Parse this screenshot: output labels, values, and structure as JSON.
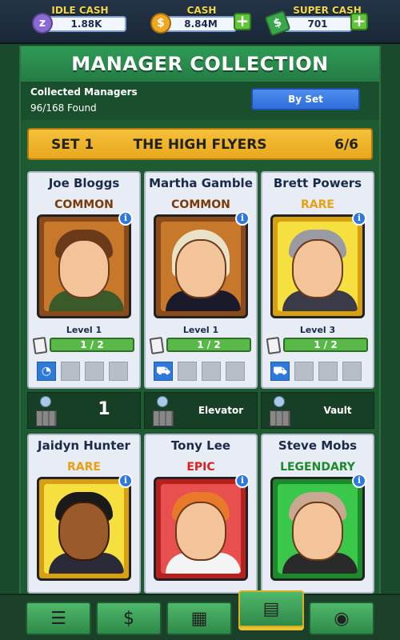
{
  "topbar": {
    "idle_cash": {
      "label": "IDLE CASH",
      "value": "1.88K",
      "icon": "idle-cash-icon"
    },
    "cash": {
      "label": "CASH",
      "value": "8.84M",
      "icon": "dollar-coin-icon"
    },
    "super_cash": {
      "label": "SUPER CASH",
      "value": "701",
      "icon": "super-cash-icon"
    }
  },
  "title": "MANAGER COLLECTION",
  "collected": {
    "label": "Collected Managers",
    "count": "96/168 Found"
  },
  "by_set_button": "By Set",
  "set": {
    "number": "SET 1",
    "name": "THE HIGH FLYERS",
    "progress": "6/6"
  },
  "managers": [
    {
      "name": "Joe Bloggs",
      "rarity": "COMMON",
      "rarity_color": "#7a3a0a",
      "level": "Level 1",
      "cards": "1 / 2",
      "frame": "#8a4a1a",
      "bg": "#c8782a",
      "hair": "#6a3a1a",
      "body": "#3a5a2a"
    },
    {
      "name": "Martha Gamble",
      "rarity": "COMMON",
      "rarity_color": "#7a3a0a",
      "level": "Level 1",
      "cards": "1 / 2",
      "frame": "#8a4a1a",
      "bg": "#c8782a",
      "hair": "#eae2c8",
      "body": "#1a1a2a"
    },
    {
      "name": "Brett Powers",
      "rarity": "RARE",
      "rarity_color": "#e8a010",
      "level": "Level 3",
      "cards": "1 / 2",
      "frame": "#d8a010",
      "bg": "#f6e040",
      "hair": "#9a9aa2",
      "body": "#3a3a48"
    },
    {
      "name": "Jaidyn Hunter",
      "rarity": "RARE",
      "rarity_color": "#e8a010",
      "frame": "#d8a010",
      "bg": "#f6e040",
      "hair": "#1a1a1a",
      "body": "#2a2a38",
      "skin": "#9a5a2a"
    },
    {
      "name": "Tony Lee",
      "rarity": "EPIC",
      "rarity_color": "#d82020",
      "frame": "#b82020",
      "bg": "#e85050",
      "hair": "#e8782a",
      "body": "#f4f4f4"
    },
    {
      "name": "Steve Mobs",
      "rarity": "LEGENDARY",
      "rarity_color": "#1a8a2a",
      "frame": "#1a8a2a",
      "bg": "#3ac84a",
      "hair": "#c8a890",
      "body": "#2a2a2a"
    }
  ],
  "strips": [
    {
      "value": "1",
      "icon": "manager-statue-icon"
    },
    {
      "value": "Elevator",
      "icon": "manager-statue-icon"
    },
    {
      "value": "Vault",
      "icon": "manager-statue-icon"
    }
  ],
  "nav": [
    {
      "icon": "checklist-icon"
    },
    {
      "icon": "cash-briefcase-icon"
    },
    {
      "icon": "building-icon"
    },
    {
      "icon": "id-card-icon"
    },
    {
      "icon": "map-pin-icon"
    }
  ]
}
